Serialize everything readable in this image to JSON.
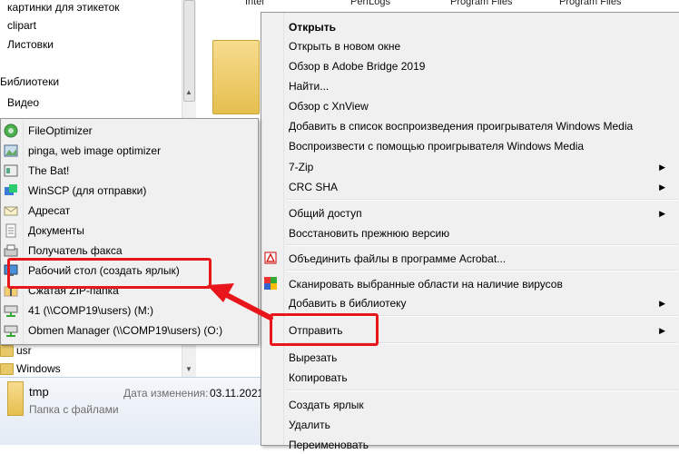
{
  "nav_pane": {
    "items": [
      {
        "label": "картинки для этикеток",
        "folder": true
      },
      {
        "label": "clipart",
        "folder": true
      },
      {
        "label": "Листовки",
        "folder": true
      },
      {
        "label": "Библиотеки",
        "folder": false
      },
      {
        "label": "Видео",
        "folder": false
      }
    ],
    "bottom_items": [
      {
        "label": "usr"
      },
      {
        "label": "Windows"
      }
    ]
  },
  "content": {
    "top_labels": [
      "Intel",
      "PerfLogs",
      "Program Files",
      "Program Files"
    ]
  },
  "details": {
    "name": "tmp",
    "date_label": "Дата изменения:",
    "date_value": "03.11.2021",
    "type": "Папка с файлами"
  },
  "context_menu": {
    "open": "Открыть",
    "open_new_window": "Открыть в новом окне",
    "bridge": "Обзор в Adobe Bridge 2019",
    "find": "Найти...",
    "xnview": "Обзор с XnView",
    "wmp_add": "Добавить в список воспроизведения проигрывателя Windows Media",
    "wmp_play": "Воспроизвести с помощью проигрывателя Windows Media",
    "zip": "7-Zip",
    "crc": "CRC SHA",
    "share": "Общий доступ",
    "restore": "Восстановить прежнюю версию",
    "acrobat": "Объединить файлы в программе Acrobat...",
    "scan": "Сканировать выбранные области на наличие вирусов",
    "library": "Добавить в библиотеку",
    "send_to": "Отправить",
    "cut": "Вырезать",
    "copy": "Копировать",
    "shortcut": "Создать ярлык",
    "delete": "Удалить",
    "rename": "Переименовать"
  },
  "sendto_menu": {
    "items": [
      {
        "label": "FileOptimizer",
        "icon": "fileoptimizer-icon"
      },
      {
        "label": "pinga, web image optimizer",
        "icon": "pinga-icon"
      },
      {
        "label": "The Bat!",
        "icon": "thebat-icon"
      },
      {
        "label": "WinSCP (для отправки)",
        "icon": "winscp-icon"
      },
      {
        "label": "Адресат",
        "icon": "mail-recipient-icon"
      },
      {
        "label": "Документы",
        "icon": "documents-icon"
      },
      {
        "label": "Получатель факса",
        "icon": "fax-icon"
      },
      {
        "label": "Рабочий стол (создать ярлык)",
        "icon": "desktop-icon"
      },
      {
        "label": "Сжатая ZIP-папка",
        "icon": "zip-folder-icon"
      },
      {
        "label": "41 (\\\\COMP19\\users) (M:)",
        "icon": "network-drive-icon"
      },
      {
        "label": "Obmen Manager (\\\\COMP19\\users) (O:)",
        "icon": "network-drive-icon"
      }
    ]
  },
  "colors": {
    "highlight": "#e8161b",
    "menu_bg": "#f0f0f0"
  }
}
